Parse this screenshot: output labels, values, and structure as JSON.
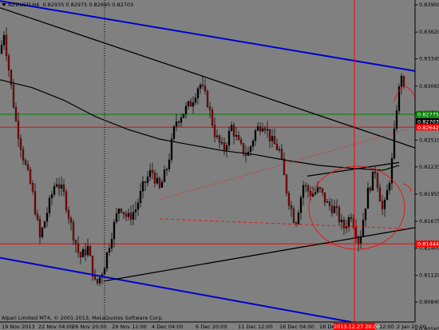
{
  "header": {
    "symbol": "NZDUSD,H4",
    "ohlc": "0.82935 0.82975 0.82695 0.82703"
  },
  "copyright": "Alpari Limited MT4, © 2001-2013, MetaQuotes Software Corp.",
  "colors": {
    "background": "#808080",
    "candle_up": "#000000",
    "candle_down": "#8b0000",
    "channel_line": "#0000cc",
    "trend_line": "#000000",
    "support_red": "#ff0000",
    "resistance_green": "#008000",
    "moving_average": "#000000",
    "annotation": "#ff0000",
    "axis_panel": "#808080"
  },
  "chart_data": {
    "type": "candlestick",
    "instrument": "NZDUSD",
    "timeframe": "H4",
    "ylim": [
      0.8064,
      0.8395
    ],
    "price_ticks": [
      "0.83900",
      "0.83620",
      "0.83345",
      "0.83065",
      "0.82790",
      "0.82510",
      "0.82235",
      "0.81955",
      "0.81675",
      "0.81400",
      "0.81120",
      "0.80845",
      "0.80565"
    ],
    "x_labels": [
      "19 Nov 2013",
      "22 Nov 04:00",
      "26 Nov 20:00",
      "29 Nov 12:00",
      "4 Dec 04:00",
      "6 Dec 20:00",
      "11 Dec 12:00",
      "16 Dec 04:00",
      "18 Dec 20:00",
      "23 Dec 12:00",
      "2013.12.27 20:00",
      "2 Jan 20:00"
    ],
    "highlighted_time": "2013.12.27 20:00",
    "price_boxes": [
      {
        "label": "0.82775",
        "value": 0.82775,
        "color": "#008000"
      },
      {
        "label": "0.82703",
        "value": 0.82703,
        "color": "#000000"
      },
      {
        "label": "0.82642",
        "value": 0.82642,
        "color": "#ff0000"
      },
      {
        "label": "0.81444",
        "value": 0.81444,
        "color": "#ff0000"
      }
    ],
    "horizontal_lines": [
      {
        "value": 0.82775,
        "color": "#008000"
      },
      {
        "value": 0.82642,
        "color": "#ff0000"
      },
      {
        "value": 0.81444,
        "color": "#ff0000"
      }
    ],
    "close_path": [
      [
        0,
        0.834
      ],
      [
        5,
        0.8362
      ],
      [
        10,
        0.833
      ],
      [
        20,
        0.827
      ],
      [
        30,
        0.823
      ],
      [
        40,
        0.82
      ],
      [
        50,
        0.815
      ],
      [
        60,
        0.818
      ],
      [
        70,
        0.821
      ],
      [
        80,
        0.8195
      ],
      [
        90,
        0.816
      ],
      [
        100,
        0.813
      ],
      [
        110,
        0.814
      ],
      [
        120,
        0.81
      ],
      [
        130,
        0.812
      ],
      [
        140,
        0.8155
      ],
      [
        150,
        0.8185
      ],
      [
        160,
        0.817
      ],
      [
        170,
        0.818
      ],
      [
        180,
        0.8205
      ],
      [
        190,
        0.822
      ],
      [
        200,
        0.82
      ],
      [
        210,
        0.8225
      ],
      [
        220,
        0.827
      ],
      [
        230,
        0.828
      ],
      [
        240,
        0.829
      ],
      [
        250,
        0.831
      ],
      [
        260,
        0.829
      ],
      [
        270,
        0.8255
      ],
      [
        280,
        0.824
      ],
      [
        290,
        0.8265
      ],
      [
        300,
        0.8245
      ],
      [
        310,
        0.8235
      ],
      [
        320,
        0.826
      ],
      [
        330,
        0.827
      ],
      [
        340,
        0.825
      ],
      [
        350,
        0.824
      ],
      [
        360,
        0.8195
      ],
      [
        370,
        0.8165
      ],
      [
        380,
        0.8205
      ],
      [
        390,
        0.8195
      ],
      [
        400,
        0.82
      ],
      [
        410,
        0.8185
      ],
      [
        420,
        0.818
      ],
      [
        430,
        0.816
      ],
      [
        440,
        0.8175
      ],
      [
        450,
        0.8145
      ],
      [
        460,
        0.8195
      ],
      [
        470,
        0.822
      ],
      [
        480,
        0.8175
      ],
      [
        490,
        0.822
      ],
      [
        497,
        0.8285
      ],
      [
        503,
        0.832
      ],
      [
        507,
        0.8295
      ]
    ],
    "moving_average": [
      [
        0,
        0.8313
      ],
      [
        40,
        0.8305
      ],
      [
        80,
        0.8292
      ],
      [
        120,
        0.8275
      ],
      [
        160,
        0.8262
      ],
      [
        200,
        0.8252
      ],
      [
        240,
        0.8246
      ],
      [
        280,
        0.824
      ],
      [
        320,
        0.8236
      ],
      [
        360,
        0.823
      ],
      [
        400,
        0.8225
      ],
      [
        440,
        0.8222
      ],
      [
        480,
        0.822
      ],
      [
        500,
        0.8225
      ]
    ],
    "trendlines": [
      {
        "points": [
          [
            0,
            0.8387
          ],
          [
            520,
            0.8243
          ]
        ],
        "color": "#000000",
        "style": "solid"
      },
      {
        "points": [
          [
            0,
            0.8394
          ],
          [
            520,
            0.8322
          ]
        ],
        "color": "#0000cc",
        "style": "solid"
      },
      {
        "points": [
          [
            0,
            0.813
          ],
          [
            440,
            0.8064
          ]
        ],
        "color": "#0000cc",
        "style": "solid"
      },
      {
        "points": [
          [
            130,
            0.8106
          ],
          [
            520,
            0.8161
          ]
        ],
        "color": "#000000",
        "style": "solid"
      },
      {
        "points": [
          [
            385,
            0.8214
          ],
          [
            500,
            0.8228
          ]
        ],
        "color": "#000000",
        "style": "solid"
      },
      {
        "points": [
          [
            200,
            0.819
          ],
          [
            510,
            0.8262
          ]
        ],
        "color": "#ff0000",
        "style": "dotted"
      },
      {
        "points": [
          [
            200,
            0.817
          ],
          [
            510,
            0.816
          ]
        ],
        "color": "#ff0000",
        "style": "dashed"
      }
    ],
    "vertical_lines": [
      {
        "x": 444,
        "color": "#ff0000"
      },
      {
        "x": 131,
        "color": "#000000",
        "style": "dotted"
      }
    ]
  }
}
